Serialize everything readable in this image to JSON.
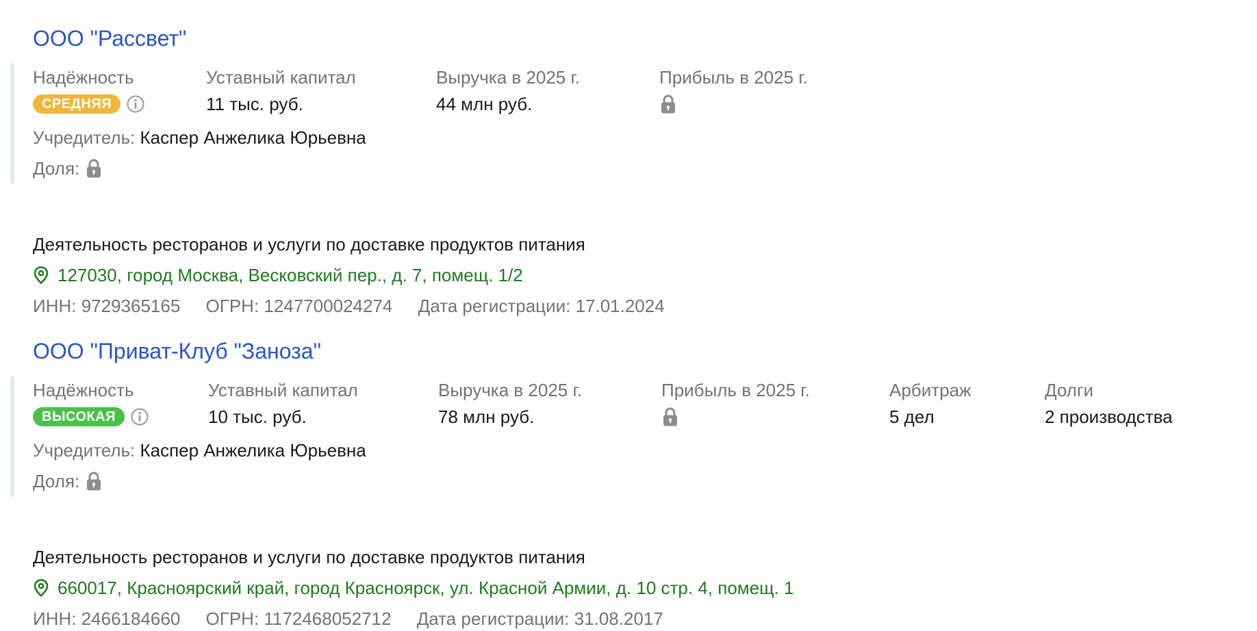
{
  "companies": [
    {
      "name": "ООО \"Рассвет\"",
      "reliability": {
        "label": "Надёжность",
        "value": "СРЕДНЯЯ",
        "color": "#f0b63c"
      },
      "capital": {
        "label": "Уставный капитал",
        "value": "11 тыс. руб."
      },
      "revenue": {
        "label": "Выручка в 2025 г.",
        "value": "44 млн руб."
      },
      "profit": {
        "label": "Прибыль в 2025 г.",
        "locked": true
      },
      "founder": {
        "label": "Учредитель:",
        "value": "Каспер Анжелика Юрьевна"
      },
      "share": {
        "label": "Доля:",
        "locked": true
      },
      "activity": "Деятельность ресторанов и услуги по доставке продуктов питания",
      "address": "127030, город Москва, Весковский пер., д. 7, помещ. 1/2",
      "inn": "ИНН: 9729365165",
      "ogrn": "ОГРН: 1247700024274",
      "registration": "Дата регистрации: 17.01.2024"
    },
    {
      "name": "ООО \"Приват-Клуб \"Заноза\"",
      "reliability": {
        "label": "Надёжность",
        "value": "ВЫСОКАЯ",
        "color": "#4cc04c"
      },
      "capital": {
        "label": "Уставный капитал",
        "value": "10 тыс. руб."
      },
      "revenue": {
        "label": "Выручка в 2025 г.",
        "value": "78 млн руб."
      },
      "profit": {
        "label": "Прибыль в 2025 г.",
        "locked": true
      },
      "arbitration": {
        "label": "Арбитраж",
        "value": "5 дел"
      },
      "debts": {
        "label": "Долги",
        "value": "2 производства"
      },
      "founder": {
        "label": "Учредитель:",
        "value": "Каспер Анжелика Юрьевна"
      },
      "share": {
        "label": "Доля:",
        "locked": true
      },
      "activity": "Деятельность ресторанов и услуги по доставке продуктов питания",
      "address": "660017, Красноярский край, город Красноярск, ул. Красной Армии, д. 10 стр. 4, помещ. 1",
      "inn": "ИНН: 2466184660",
      "ogrn": "ОГРН: 1172468052712",
      "registration": "Дата регистрации: 31.08.2017"
    }
  ],
  "icons": {
    "info": "info-icon",
    "lock": "lock-icon",
    "location": "location-pin-icon"
  },
  "colors": {
    "link": "#2a55c6",
    "address": "#1e7b1e",
    "muted": "#737373",
    "rail": "#e2e8f5"
  }
}
